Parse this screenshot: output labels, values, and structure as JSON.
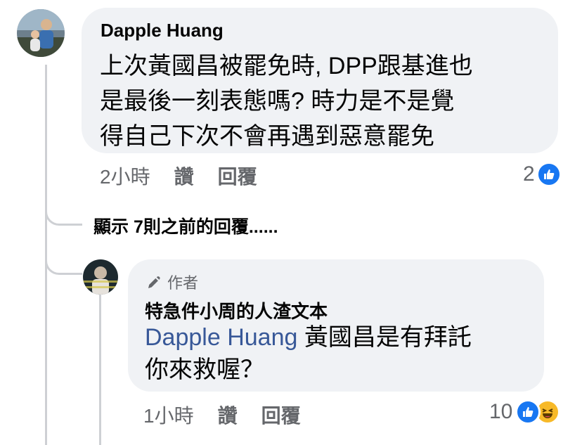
{
  "comment": {
    "author": "Dapple Huang",
    "text_lines": [
      "上次黃國昌被罷免時, DPP跟基進也",
      "是最後一刻表態嗎? 時力是不是覺",
      "得自己下次不會再遇到惡意罷免"
    ],
    "time": "2小時",
    "like_label": "讚",
    "reply_label": "回覆",
    "reaction_count": "2"
  },
  "more_replies": "顯示 7則之前的回覆......",
  "reply": {
    "badge": "作者",
    "author": "特急件小周的人渣文本",
    "mention": "Dapple Huang",
    "text_line1": " 黃國昌是有拜託",
    "text_line2": "你來救喔？",
    "time": "1小時",
    "like_label": "讚",
    "reply_label": "回覆",
    "reaction_count": "10"
  },
  "colors": {
    "like_blue": "#1877f2",
    "haha_yellow": "#f7b928",
    "bubble": "#f0f2f5",
    "meta": "#65676b"
  }
}
